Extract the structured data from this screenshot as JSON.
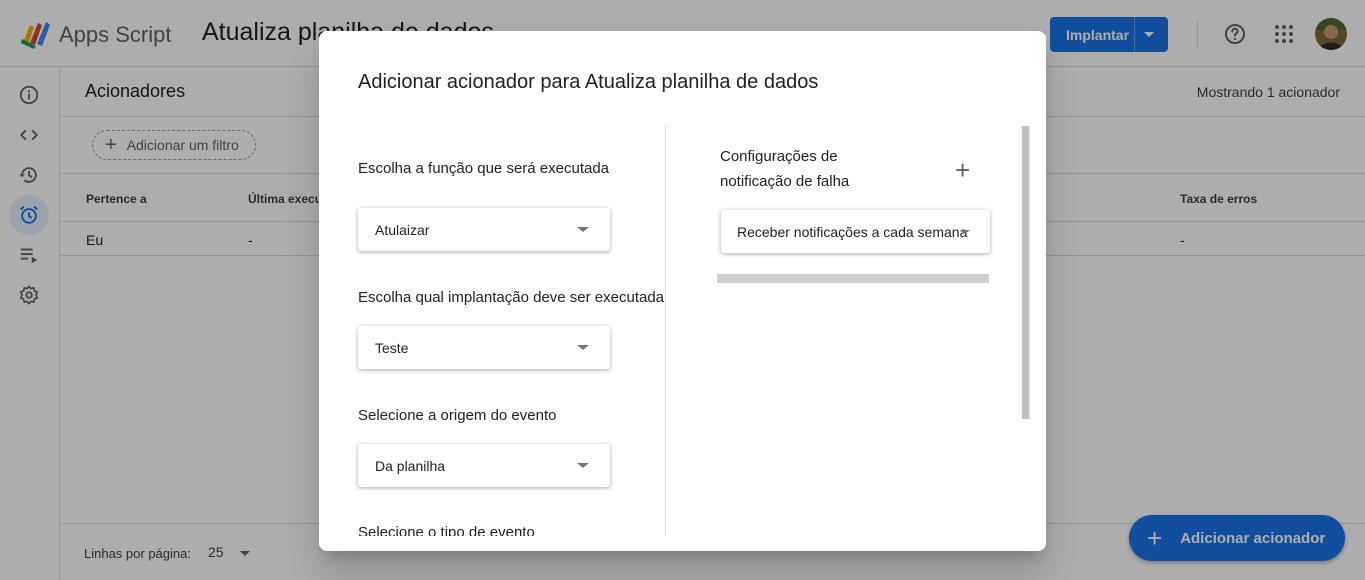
{
  "header": {
    "app_name": "Apps Script",
    "project_title": "Atualiza planilha de dados",
    "deploy_label": "Implantar"
  },
  "rail": {
    "items": [
      {
        "icon": "info-icon"
      },
      {
        "icon": "code-icon"
      },
      {
        "icon": "history-icon"
      },
      {
        "icon": "alarm-icon",
        "active": true
      },
      {
        "icon": "executions-icon"
      },
      {
        "icon": "gear-icon"
      }
    ]
  },
  "main": {
    "title": "Acionadores",
    "count_label": "Mostrando 1 acionador",
    "filter_label": "Adicionar um filtro",
    "columns": [
      "Pertence a",
      "Última execução",
      "Taxa de erros"
    ],
    "rows": [
      {
        "owner": "Eu",
        "last_run": "-",
        "error_rate": "-"
      }
    ],
    "rows_per_page_label": "Linhas por página:",
    "rows_per_page_value": "25",
    "add_trigger_label": "Adicionar acionador"
  },
  "modal": {
    "title": "Adicionar acionador para Atualiza planilha de dados",
    "function_label": "Escolha a função que será executada",
    "function_value": "Atulaizar",
    "deployment_label": "Escolha qual implantação deve ser executada",
    "deployment_value": "Teste",
    "event_source_label": "Selecione a origem do evento",
    "event_source_value": "Da planilha",
    "event_type_label": "Selecione o tipo de evento",
    "notify_label": "Configurações de notificação de falha",
    "notify_value": "Receber notificações a cada semana"
  }
}
